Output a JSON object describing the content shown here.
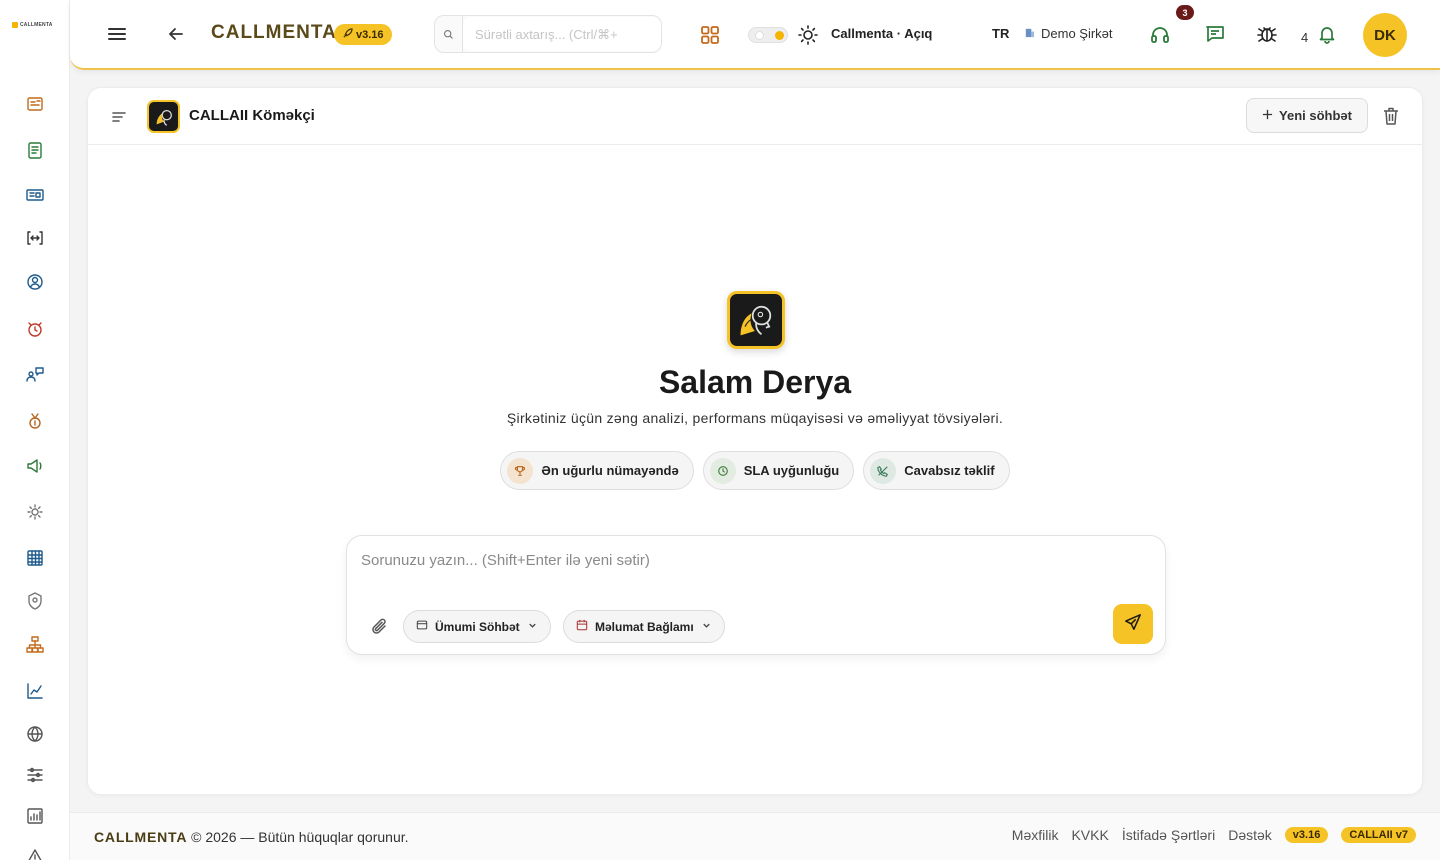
{
  "sidebar": {
    "logo_text": "CALLMENTA",
    "icons": [
      "dashboard-icon",
      "clipboard-icon",
      "reports-icon",
      "integration-icon",
      "user-circle-icon",
      "alarm-icon",
      "user-chat-icon",
      "medal-icon",
      "megaphone-icon",
      "settings-gear-icon",
      "grid-table-icon",
      "shield-icon",
      "org-chart-icon",
      "analytics-chart-icon",
      "globe-icon",
      "list-settings-icon",
      "bar-stats-icon",
      "warning-icon"
    ]
  },
  "topbar": {
    "brand": "CALLMENTA",
    "version": "v3.16",
    "search_placeholder": "Sürətli axtarış... (Ctrl/⌘+",
    "theme_label": "Callmenta · Açıq",
    "lang": "TR",
    "company": "Demo Şirkət",
    "headset_badge": "3",
    "notif_count": "4",
    "avatar_initials": "DK"
  },
  "chat": {
    "title": "CALLAII Köməkçi",
    "new_chat_label": "Yeni söhbət",
    "greeting": "Salam Derya",
    "subtitle": "Şirkətiniz üçün zəng analizi, performans müqayisəsi və əməliyyat tövsiyələri.",
    "suggestions": [
      {
        "label": "Ən uğurlu nümayəndə",
        "icon": "trophy-icon"
      },
      {
        "label": "SLA uyğunluğu",
        "icon": "clock-icon"
      },
      {
        "label": "Cavabsız təklif",
        "icon": "phone-missed-icon"
      }
    ],
    "input_placeholder": "Sorunuzu yazın... (Shift+Enter ilə yeni sətir)",
    "mode_select": "Ümumi Söhbət",
    "context_select": "Məlumat Bağlamı"
  },
  "footer": {
    "brand": "CALLMENTA",
    "copyright": "© 2026 — Bütün hüquqlar qorunur.",
    "links": [
      "Məxfilik",
      "KVKK",
      "İstifadə Şərtləri",
      "Dəstək"
    ],
    "version_badge": "v3.16",
    "ai_badge": "CALLAII v7"
  },
  "colors": {
    "accent": "#f5c325",
    "brand_text": "#5a4a1a",
    "icon_blue": "#1e5a8c",
    "icon_orange": "#c46a1a",
    "icon_green": "#2a7a3a"
  }
}
